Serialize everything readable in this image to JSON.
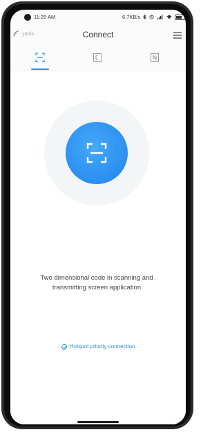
{
  "status_bar": {
    "time": "11:29 AM",
    "network_speed": "6.7KB/s",
    "icons": [
      "bluetooth-icon",
      "alarm-icon",
      "signal-icon",
      "wifi-icon",
      "battery-icon"
    ]
  },
  "app_bar": {
    "wifi_name": "yanfa",
    "title": "Connect",
    "menu_icon": "menu-icon"
  },
  "tabs": [
    {
      "icon": "scan-icon",
      "active": true
    },
    {
      "icon": "code-icon",
      "active": false
    },
    {
      "icon": "nfc-icon",
      "active": false
    }
  ],
  "main": {
    "scan_icon": "qr-scan-icon",
    "description": "Two dimensional code in scanning and transmitting screen application",
    "hotspot_link": "Hotspot priority connection"
  },
  "colors": {
    "accent": "#2a8ce8",
    "scan_button": "#2b8ff0",
    "halo": "#f4f5f7"
  }
}
